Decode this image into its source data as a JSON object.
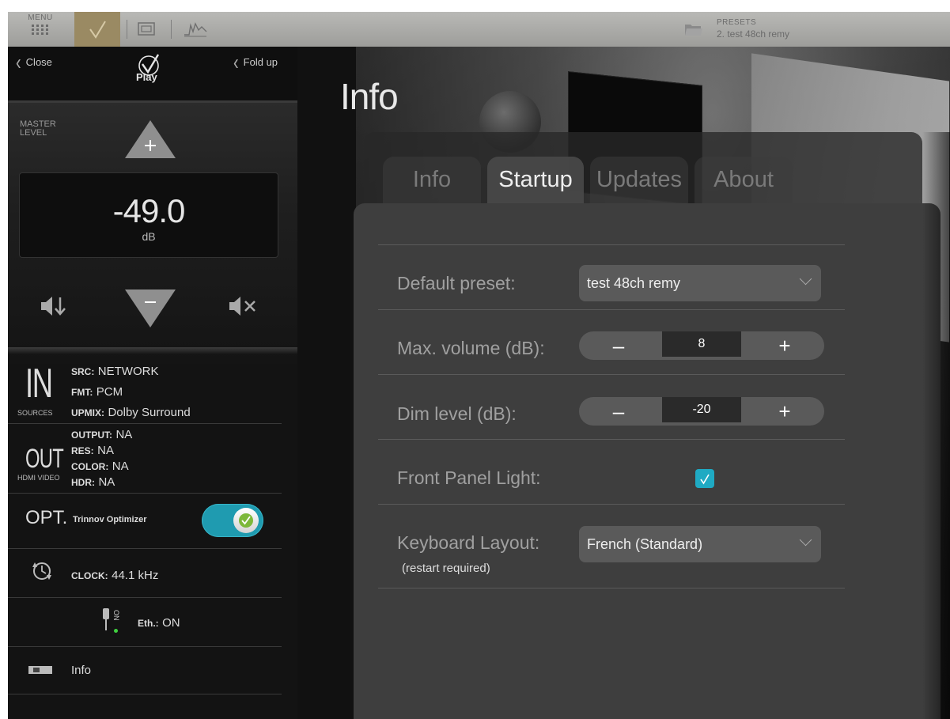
{
  "topbar": {
    "menu_label": "MENU",
    "presets_label": "PRESETS",
    "presets_value": "2. test 48ch remy"
  },
  "sidebar": {
    "close_label": "Close",
    "foldup_label": "Fold up",
    "logo_text": "Play",
    "master_label_line1": "MASTER",
    "master_label_line2": "LEVEL",
    "volume_value": "-49.0",
    "volume_unit": "dB",
    "in": {
      "big": "IN",
      "sub": "SOURCES",
      "src_key": "SRC:",
      "src_val": "NETWORK",
      "fmt_key": "FMT:",
      "fmt_val": "PCM",
      "upmix_key": "UPMIX:",
      "upmix_val": "Dolby Surround"
    },
    "out": {
      "big": "OUT",
      "sub": "HDMI VIDEO",
      "output_key": "OUTPUT:",
      "output_val": "NA",
      "res_key": "RES:",
      "res_val": "NA",
      "color_key": "COLOR:",
      "color_val": "NA",
      "hdr_key": "HDR:",
      "hdr_val": "NA"
    },
    "opt": {
      "big": "OPT.",
      "label": "Trinnov Optimizer",
      "enabled": true
    },
    "clock": {
      "key": "CLOCK:",
      "val": "44.1 kHz"
    },
    "eth": {
      "status_small": "ON",
      "key": "Eth.:",
      "val": "ON"
    },
    "info_label": "Info"
  },
  "main": {
    "title": "Info",
    "tabs": [
      {
        "label": "Info",
        "active": false
      },
      {
        "label": "Startup",
        "active": true
      },
      {
        "label": "Updates",
        "active": false
      },
      {
        "label": "About",
        "active": false
      }
    ],
    "startup": {
      "default_preset_label": "Default preset:",
      "default_preset_value": "test 48ch remy",
      "max_volume_label": "Max. volume (dB):",
      "max_volume_value": "8",
      "dim_level_label": "Dim level (dB):",
      "dim_level_value": "-20",
      "minus_symbol": "–",
      "plus_symbol": "+",
      "front_panel_label": "Front Panel Light:",
      "front_panel_checked": true,
      "keyboard_layout_label": "Keyboard Layout:",
      "keyboard_layout_hint": "(restart required)",
      "keyboard_layout_value": "French (Standard)"
    }
  },
  "colors": {
    "accent": "#1faac3",
    "topbar_active": "#9a8a63"
  }
}
